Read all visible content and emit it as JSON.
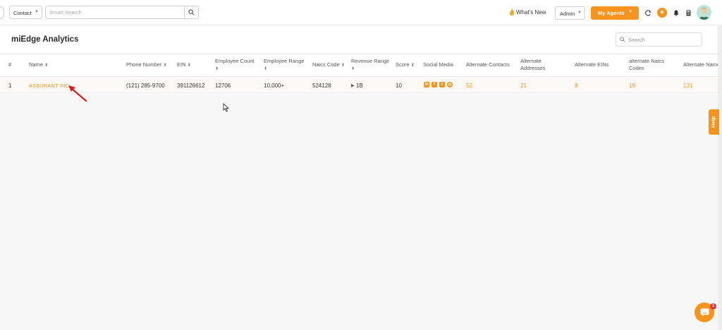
{
  "topbar": {
    "entity_select": "Contact",
    "search_placeholder": "Smart Search",
    "whats_new": "What's New",
    "role_select": "Admin",
    "agents_button": "My Agents"
  },
  "page": {
    "title": "miEdge Analytics",
    "search_placeholder": "Search"
  },
  "table": {
    "headers": {
      "index": "#",
      "name": "Name",
      "phone": "Phone Number",
      "ein": "EIN",
      "employee_count": "Employee Count",
      "employee_range": "Employee Range",
      "naics_code": "Naics Code",
      "revenue_range": "Revenue Range",
      "score": "Score",
      "social_media": "Social Media",
      "alt_contacts": "Alternate Contacts",
      "alt_addresses_1": "Alternate",
      "alt_addresses_2": "Addresses",
      "alt_eins": "Alternate EINs",
      "alt_naics_1": "alternate Naics",
      "alt_naics_2": "Codes",
      "alt_names": "Alternate Names"
    },
    "rows": [
      {
        "index": "1",
        "name": "ASSURANT INC",
        "phone": "(121) 285-9700",
        "ein": "391126612",
        "employee_count": "12706",
        "employee_range": "10,000+",
        "naics_code": "524128",
        "revenue_range": "1B",
        "score": "10",
        "social_icons": [
          "linkedin-icon",
          "facebook-icon",
          "twitter-icon",
          "globe-icon"
        ],
        "alt_contacts": "52",
        "alt_addresses": "21",
        "alt_eins": "8",
        "alt_naics": "19",
        "alt_names": "131"
      }
    ]
  },
  "help_tab": "Help",
  "chat_badge": "1",
  "colors": {
    "accent": "#f7941d",
    "annotation_arrow": "#e01b1b"
  }
}
